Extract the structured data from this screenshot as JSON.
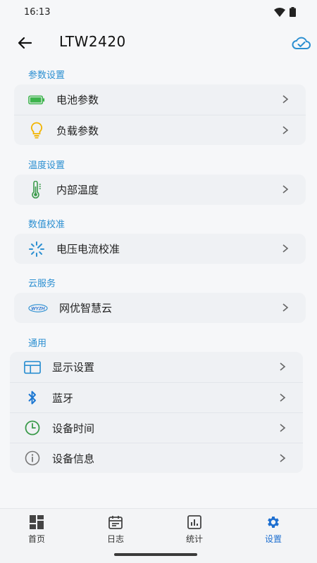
{
  "status_bar": {
    "time": "16:13",
    "icons": [
      "wifi-icon",
      "battery-icon"
    ]
  },
  "header": {
    "title": "LTW2420",
    "back_icon": "back-arrow-icon",
    "action_icon": "cloud-check-icon"
  },
  "sections": [
    {
      "label": "参数设置",
      "items": [
        {
          "label": "电池参数",
          "icon": "battery-icon"
        },
        {
          "label": "负载参数",
          "icon": "lightbulb-icon"
        }
      ]
    },
    {
      "label": "温度设置",
      "items": [
        {
          "label": "内部温度",
          "icon": "thermometer-icon"
        }
      ]
    },
    {
      "label": "数值校准",
      "items": [
        {
          "label": "电压电流校准",
          "icon": "calibration-icon"
        }
      ]
    },
    {
      "label": "云服务",
      "items": [
        {
          "label": "网优智慧云",
          "icon": "wyzh-logo-icon",
          "logo_text": "WYZH"
        }
      ]
    },
    {
      "label": "通用",
      "items": [
        {
          "label": "显示设置",
          "icon": "display-icon"
        },
        {
          "label": "蓝牙",
          "icon": "bluetooth-icon"
        },
        {
          "label": "设备时间",
          "icon": "clock-icon"
        },
        {
          "label": "设备信息",
          "icon": "info-icon"
        }
      ]
    }
  ],
  "bottom_nav": [
    {
      "label": "首页",
      "icon": "grid-icon",
      "active": false
    },
    {
      "label": "日志",
      "icon": "calendar-icon",
      "active": false
    },
    {
      "label": "统计",
      "icon": "bar-chart-icon",
      "active": false
    },
    {
      "label": "设置",
      "icon": "gear-icon",
      "active": true
    }
  ],
  "colors": {
    "accent": "#2b8fd1",
    "active_nav": "#1e6fd0",
    "battery": "#3cb44b",
    "bulb": "#f2b400",
    "thermo": "#3a9a4a",
    "background": "#f6f7f9",
    "card": "#eff1f4"
  }
}
